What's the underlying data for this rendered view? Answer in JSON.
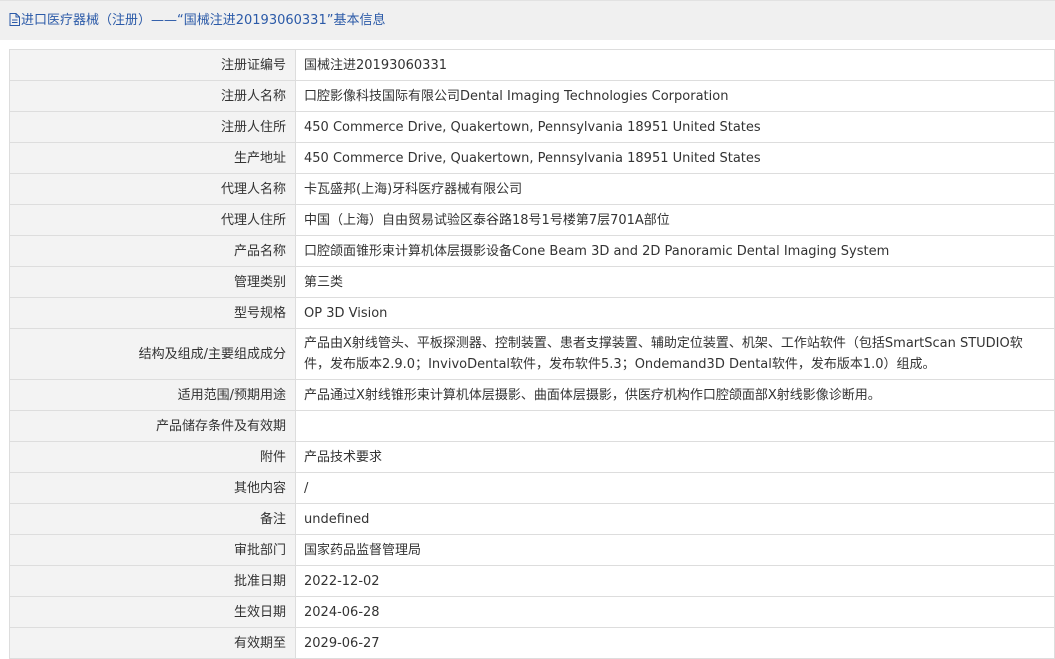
{
  "header": {
    "title": "进口医疗器械（注册）——“国械注进20193060331”基本信息",
    "icon": "document-icon",
    "accent_color": "#2b5aa8"
  },
  "rows": [
    {
      "label": "注册证编号",
      "value": "国械注进20193060331"
    },
    {
      "label": "注册人名称",
      "value": "口腔影像科技国际有限公司Dental Imaging Technologies Corporation"
    },
    {
      "label": "注册人住所",
      "value": "450 Commerce Drive, Quakertown, Pennsylvania 18951 United States"
    },
    {
      "label": "生产地址",
      "value": "450 Commerce Drive, Quakertown, Pennsylvania 18951 United States"
    },
    {
      "label": "代理人名称",
      "value": "卡瓦盛邦(上海)牙科医疗器械有限公司"
    },
    {
      "label": "代理人住所",
      "value": "中国（上海）自由贸易试验区泰谷路18号1号楼第7层701A部位"
    },
    {
      "label": "产品名称",
      "value": "口腔颌面锥形束计算机体层摄影设备Cone Beam 3D and 2D Panoramic Dental Imaging System"
    },
    {
      "label": "管理类别",
      "value": "第三类"
    },
    {
      "label": "型号规格",
      "value": "OP 3D Vision"
    },
    {
      "label": "结构及组成/主要组成成分",
      "value": "产品由X射线管头、平板探测器、控制装置、患者支撑装置、辅助定位装置、机架、工作站软件（包括SmartScan STUDIO软件，发布版本2.9.0；InvivoDental软件，发布软件5.3；Ondemand3D Dental软件，发布版本1.0）组成。"
    },
    {
      "label": "适用范围/预期用途",
      "value": "产品通过X射线锥形束计算机体层摄影、曲面体层摄影，供医疗机构作口腔颌面部X射线影像诊断用。"
    },
    {
      "label": "产品储存条件及有效期",
      "value": ""
    },
    {
      "label": "附件",
      "value": "产品技术要求"
    },
    {
      "label": "其他内容",
      "value": "/"
    },
    {
      "label": "备注",
      "value": "undefined"
    },
    {
      "label": "审批部门",
      "value": "国家药品监督管理局"
    },
    {
      "label": "批准日期",
      "value": "2022-12-02"
    },
    {
      "label": "生效日期",
      "value": "2024-06-28"
    },
    {
      "label": "有效期至",
      "value": "2029-06-27"
    }
  ]
}
